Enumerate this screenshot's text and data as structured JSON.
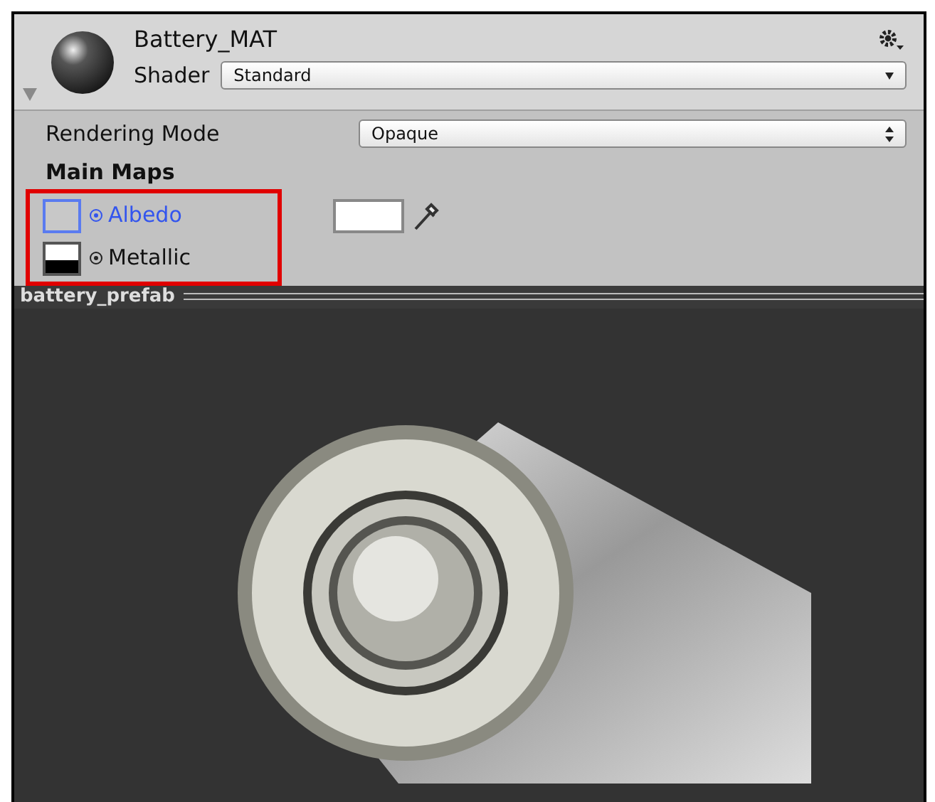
{
  "material": {
    "name": "Battery_MAT",
    "shader_label": "Shader",
    "shader": "Standard"
  },
  "rendering_mode": {
    "label": "Rendering Mode",
    "value": "Opaque"
  },
  "section": "Main Maps",
  "maps": [
    {
      "label": "Albedo",
      "selected": true,
      "kind": "color"
    },
    {
      "label": "Metallic",
      "selected": false,
      "kind": "plain"
    }
  ],
  "preview": {
    "title": "battery_prefab"
  }
}
